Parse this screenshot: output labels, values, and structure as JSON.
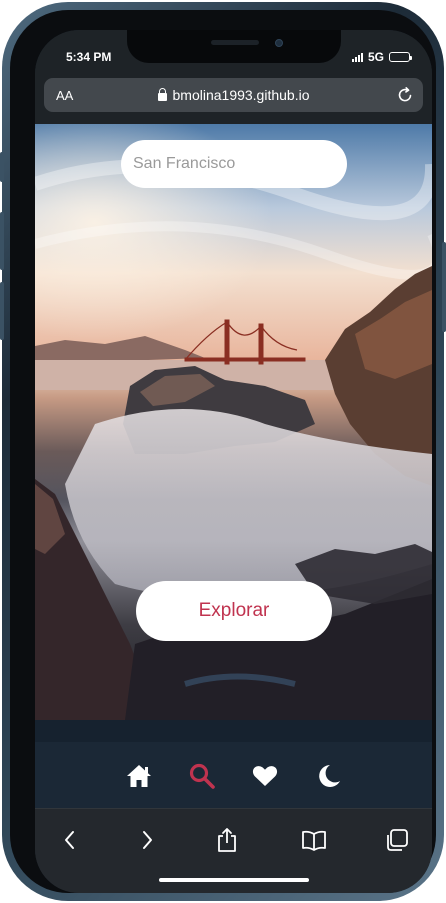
{
  "status_bar": {
    "time": "5:34 PM",
    "network": "5G",
    "signal_bars": 4,
    "battery_level": 1.0
  },
  "browser": {
    "text_size_label": "AA",
    "url": "bmolina1993.github.io",
    "reload_icon": "reload-icon",
    "lock_icon": "lock-icon"
  },
  "page": {
    "background_image": "Golden Gate bridge seascape photo",
    "search": {
      "value": "San Francisco"
    },
    "explore_button_label": "Explorar",
    "colors": {
      "accent": "#c0334f",
      "navbar_bg": "#1b2836",
      "icon_default": "#ffffff"
    }
  },
  "app_nav": [
    {
      "icon": "home-icon",
      "active": false
    },
    {
      "icon": "search-icon",
      "active": true
    },
    {
      "icon": "heart-icon",
      "active": false
    },
    {
      "icon": "moon-icon",
      "active": false
    }
  ],
  "browser_toolbar": [
    "back-icon",
    "forward-icon",
    "share-icon",
    "bookmarks-icon",
    "tabs-icon"
  ]
}
